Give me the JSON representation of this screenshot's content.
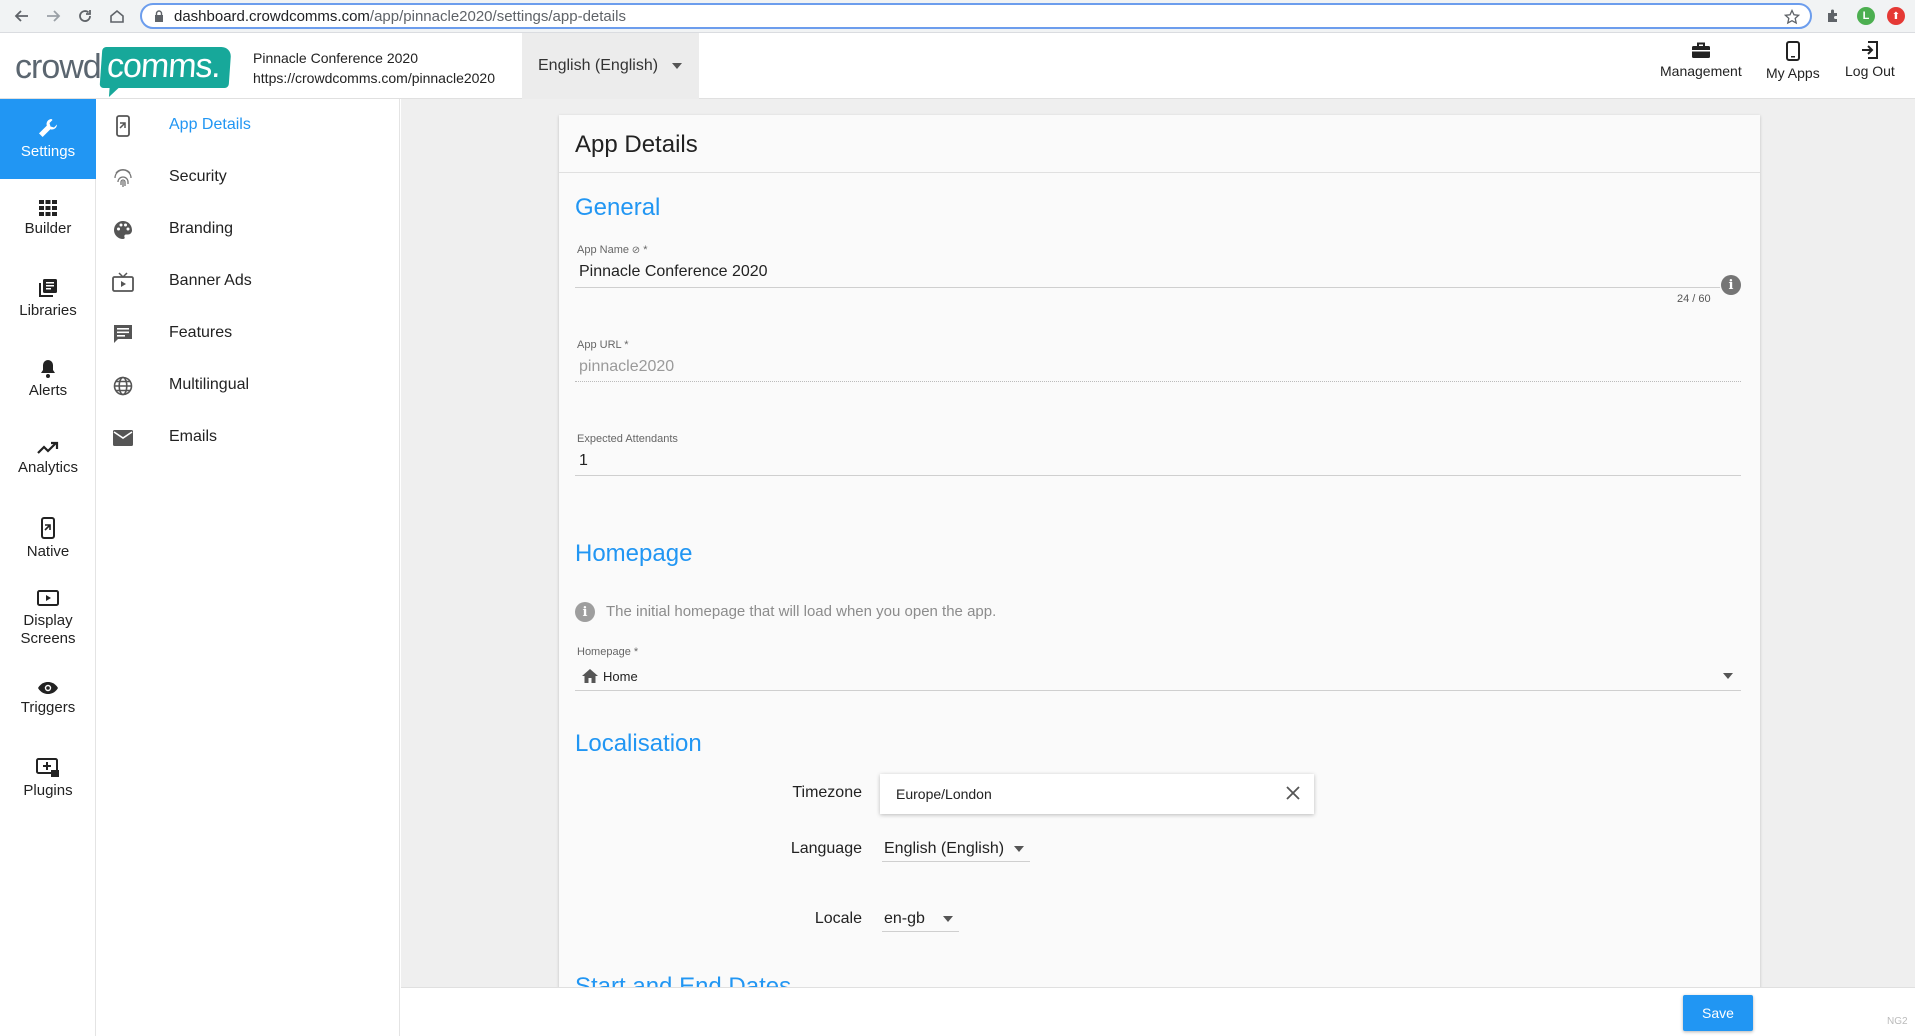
{
  "browser": {
    "url_host": "dashboard.crowdcomms.com",
    "url_path": "/app/pinnacle2020/settings/app-details",
    "profile_initial": "L"
  },
  "header": {
    "logo_crowd": "crowd",
    "logo_comms": "comms.",
    "event_name": "Pinnacle Conference 2020",
    "event_url": "https://crowdcomms.com/pinnacle2020",
    "language": "English (English)",
    "actions": [
      {
        "label": "Management",
        "icon": "briefcase-icon"
      },
      {
        "label": "My Apps",
        "icon": "phone-icon"
      },
      {
        "label": "Log Out",
        "icon": "logout-icon"
      }
    ]
  },
  "rail": {
    "items": [
      {
        "label": "Settings",
        "icon": "wrench-icon",
        "active": true
      },
      {
        "label": "Builder",
        "icon": "grid-icon"
      },
      {
        "label": "Libraries",
        "icon": "library-icon"
      },
      {
        "label": "Alerts",
        "icon": "bell-icon"
      },
      {
        "label": "Analytics",
        "icon": "trending-icon"
      },
      {
        "label": "Native",
        "icon": "device-icon"
      },
      {
        "label": "Display Screens",
        "icon": "play-screen-icon"
      },
      {
        "label": "Triggers",
        "icon": "eye-icon"
      },
      {
        "label": "Plugins",
        "icon": "plugin-icon"
      }
    ]
  },
  "subnav": {
    "items": [
      {
        "label": "App Details",
        "icon": "device-icon",
        "active": true
      },
      {
        "label": "Security",
        "icon": "fingerprint-icon"
      },
      {
        "label": "Branding",
        "icon": "palette-icon"
      },
      {
        "label": "Banner Ads",
        "icon": "tv-icon"
      },
      {
        "label": "Features",
        "icon": "chat-icon"
      },
      {
        "label": "Multilingual",
        "icon": "globe-icon"
      },
      {
        "label": "Emails",
        "icon": "mail-icon"
      }
    ]
  },
  "main": {
    "title": "App Details",
    "general": {
      "heading": "General",
      "app_name_label": "App Name",
      "app_name_value": "Pinnacle Conference 2020",
      "app_name_counter": "24 / 60",
      "app_url_label": "App URL",
      "app_url_value": "pinnacle2020",
      "attendants_label": "Expected Attendants",
      "attendants_value": "1",
      "required_mark": "*"
    },
    "homepage": {
      "heading": "Homepage",
      "hint": "The initial homepage that will load when you open the app.",
      "label": "Homepage",
      "value": "Home"
    },
    "localisation": {
      "heading": "Localisation",
      "timezone_label": "Timezone",
      "timezone_value": "Europe/London",
      "language_label": "Language",
      "language_value": "English (English)",
      "locale_label": "Locale",
      "locale_value": "en-gb"
    },
    "next_section_heading": "Start and End Dates"
  },
  "footer": {
    "save_label": "Save",
    "tag": "NG2"
  },
  "colors": {
    "accent": "#2196f3",
    "brand_teal": "#17a89a"
  }
}
